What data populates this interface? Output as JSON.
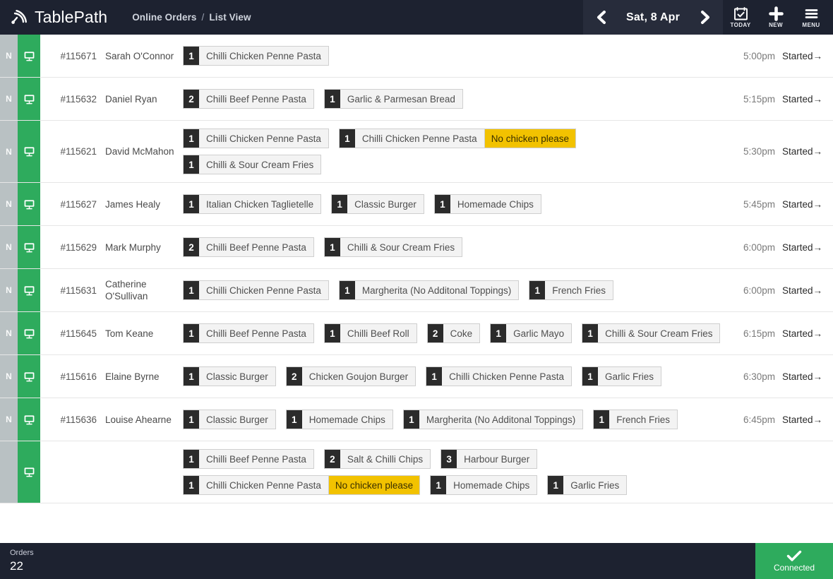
{
  "header": {
    "brand": "TablePath",
    "brand_icon": "signal-arc-icon",
    "breadcrumb": {
      "section": "Online Orders",
      "separator": "/",
      "view": "List View"
    },
    "date": "Sat, 8 Apr",
    "prev_icon": "chevron-left-icon",
    "next_icon": "chevron-right-icon",
    "tools": [
      {
        "label": "TODAY",
        "icon": "calendar-check-icon"
      },
      {
        "label": "NEW",
        "icon": "plus-icon"
      },
      {
        "label": "MENU",
        "icon": "hamburger-icon"
      }
    ],
    "accent_dark": "#1d2230",
    "accent_panel": "#272c3b"
  },
  "colors": {
    "green": "#2eab5d",
    "gray_badge": "#b9c1c3",
    "chip_qty": "#2b2b2b",
    "chip_bg": "#f3f3f3",
    "note_yellow": "#f2c200"
  },
  "orders": [
    {
      "badge": "N",
      "source_icon": "desktop-monitor-icon",
      "id": "#115671",
      "customer": "Sarah O'Connor",
      "time": "5:00pm",
      "status": "Started→",
      "items": [
        {
          "qty": "1",
          "name": "Chilli Chicken Penne Pasta",
          "note": ""
        }
      ]
    },
    {
      "badge": "N",
      "source_icon": "desktop-monitor-icon",
      "id": "#115632",
      "customer": "Daniel Ryan",
      "time": "5:15pm",
      "status": "Started→",
      "items": [
        {
          "qty": "2",
          "name": "Chilli Beef Penne Pasta",
          "note": ""
        },
        {
          "qty": "1",
          "name": "Garlic & Parmesan Bread",
          "note": ""
        }
      ]
    },
    {
      "badge": "N",
      "source_icon": "desktop-monitor-icon",
      "id": "#115621",
      "customer": "David McMahon",
      "time": "5:30pm",
      "status": "Started→",
      "items": [
        {
          "qty": "1",
          "name": "Chilli Chicken Penne Pasta",
          "note": ""
        },
        {
          "qty": "1",
          "name": "Chilli Chicken Penne Pasta",
          "note": "No chicken please"
        },
        {
          "qty": "1",
          "name": "Chilli & Sour Cream Fries",
          "note": ""
        }
      ]
    },
    {
      "badge": "N",
      "source_icon": "desktop-monitor-icon",
      "id": "#115627",
      "customer": "James Healy",
      "time": "5:45pm",
      "status": "Started→",
      "items": [
        {
          "qty": "1",
          "name": "Italian Chicken Taglietelle",
          "note": ""
        },
        {
          "qty": "1",
          "name": "Classic Burger",
          "note": ""
        },
        {
          "qty": "1",
          "name": "Homemade Chips",
          "note": ""
        }
      ]
    },
    {
      "badge": "N",
      "source_icon": "desktop-monitor-icon",
      "id": "#115629",
      "customer": "Mark Murphy",
      "time": "6:00pm",
      "status": "Started→",
      "items": [
        {
          "qty": "2",
          "name": "Chilli Beef Penne Pasta",
          "note": ""
        },
        {
          "qty": "1",
          "name": "Chilli & Sour Cream Fries",
          "note": ""
        }
      ]
    },
    {
      "badge": "N",
      "source_icon": "desktop-monitor-icon",
      "id": "#115631",
      "customer": "Catherine O'Sullivan",
      "time": "6:00pm",
      "status": "Started→",
      "items": [
        {
          "qty": "1",
          "name": "Chilli Chicken Penne Pasta",
          "note": ""
        },
        {
          "qty": "1",
          "name": "Margherita (No Additonal Toppings)",
          "note": ""
        },
        {
          "qty": "1",
          "name": "French Fries",
          "note": ""
        }
      ]
    },
    {
      "badge": "N",
      "source_icon": "desktop-monitor-icon",
      "id": "#115645",
      "customer": "Tom Keane",
      "time": "6:15pm",
      "status": "Started→",
      "items": [
        {
          "qty": "1",
          "name": "Chilli Beef Penne Pasta",
          "note": ""
        },
        {
          "qty": "1",
          "name": "Chilli Beef Roll",
          "note": ""
        },
        {
          "qty": "2",
          "name": "Coke",
          "note": ""
        },
        {
          "qty": "1",
          "name": "Garlic Mayo",
          "note": ""
        },
        {
          "qty": "1",
          "name": "Chilli & Sour Cream Fries",
          "note": ""
        }
      ]
    },
    {
      "badge": "N",
      "source_icon": "desktop-monitor-icon",
      "id": "#115616",
      "customer": "Elaine Byrne",
      "time": "6:30pm",
      "status": "Started→",
      "items": [
        {
          "qty": "1",
          "name": "Classic Burger",
          "note": ""
        },
        {
          "qty": "2",
          "name": "Chicken Goujon Burger",
          "note": ""
        },
        {
          "qty": "1",
          "name": "Chilli Chicken Penne Pasta",
          "note": ""
        },
        {
          "qty": "1",
          "name": "Garlic Fries",
          "note": ""
        }
      ]
    },
    {
      "badge": "N",
      "source_icon": "desktop-monitor-icon",
      "id": "#115636",
      "customer": "Louise Ahearne",
      "time": "6:45pm",
      "status": "Started→",
      "items": [
        {
          "qty": "1",
          "name": "Classic Burger",
          "note": ""
        },
        {
          "qty": "1",
          "name": "Homemade Chips",
          "note": ""
        },
        {
          "qty": "1",
          "name": "Margherita (No Additonal Toppings)",
          "note": ""
        },
        {
          "qty": "1",
          "name": "French Fries",
          "note": ""
        }
      ]
    },
    {
      "badge": "",
      "source_icon": "desktop-monitor-icon",
      "id": "",
      "customer": "",
      "time": "",
      "status": "",
      "items": [
        {
          "qty": "1",
          "name": "Chilli Beef Penne Pasta",
          "note": ""
        },
        {
          "qty": "2",
          "name": "Salt & Chilli Chips",
          "note": ""
        },
        {
          "qty": "3",
          "name": "Harbour Burger",
          "note": ""
        },
        {
          "qty": "1",
          "name": "Chilli Chicken Penne Pasta",
          "note": "No chicken please"
        },
        {
          "qty": "1",
          "name": "Homemade Chips",
          "note": ""
        },
        {
          "qty": "1",
          "name": "Garlic Fries",
          "note": ""
        }
      ]
    }
  ],
  "footer": {
    "orders_label": "Orders",
    "orders_count": "22",
    "connection_status": "Connected",
    "connection_icon": "check-icon"
  }
}
